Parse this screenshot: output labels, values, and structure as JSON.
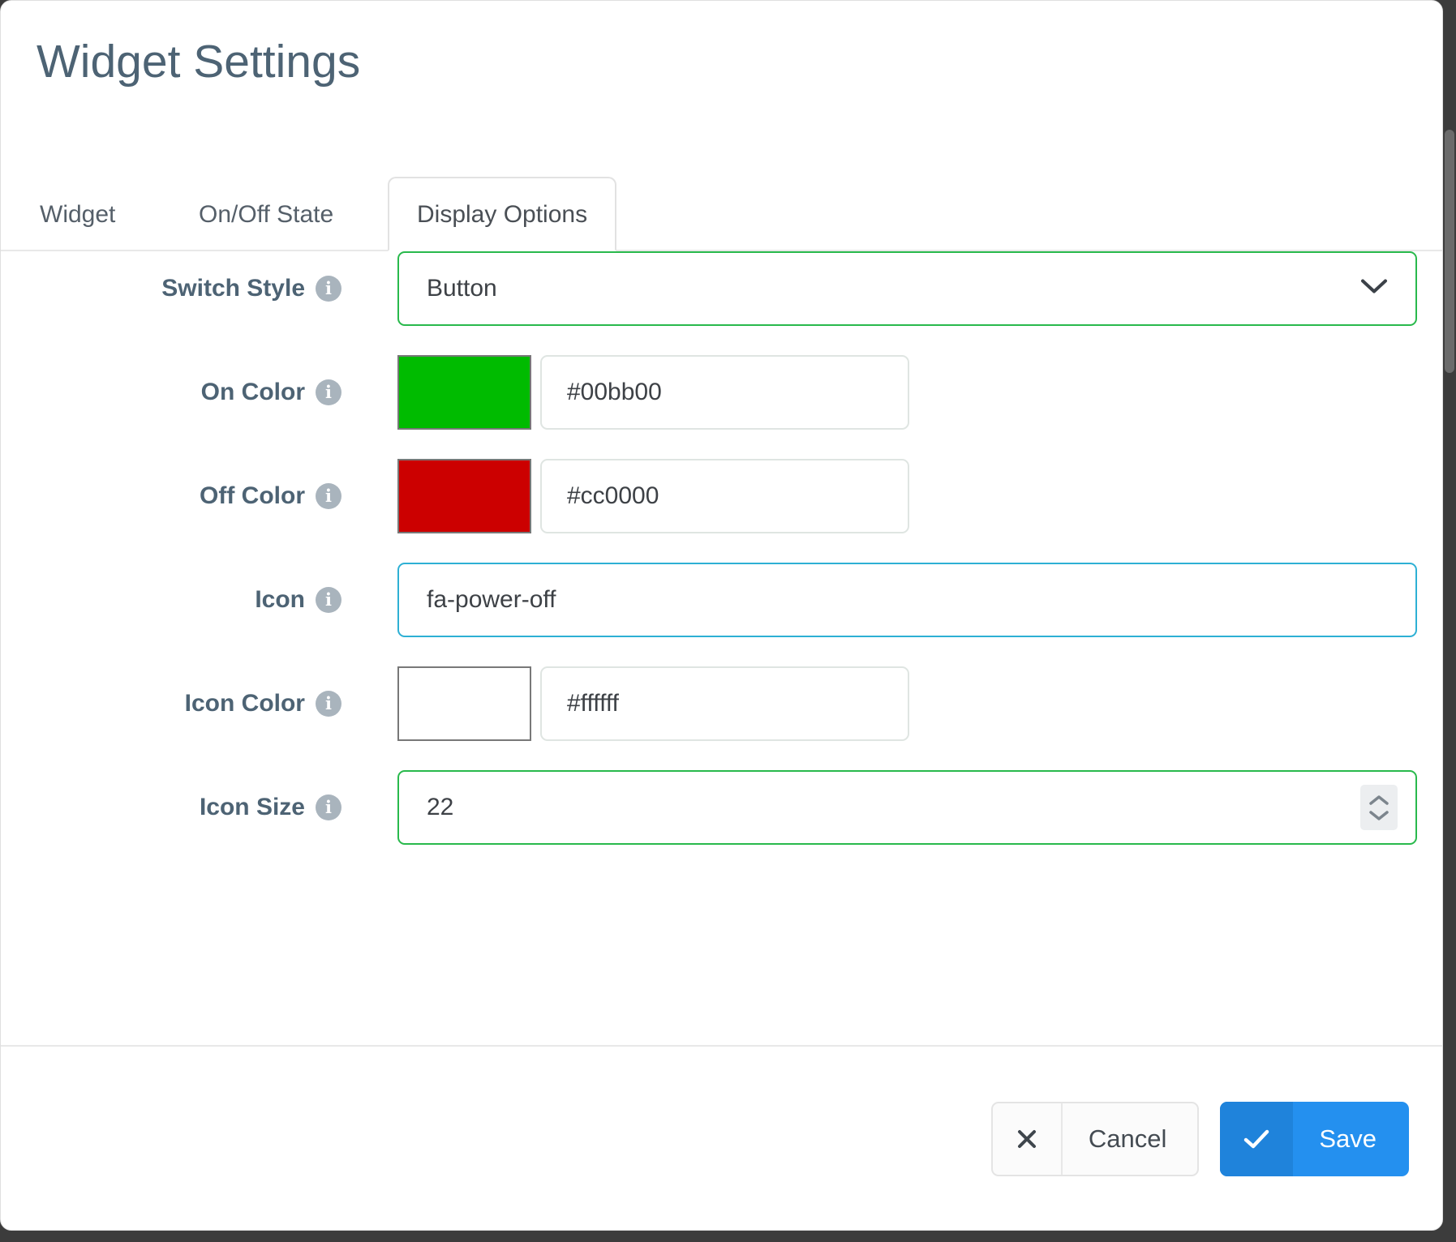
{
  "dialog": {
    "title": "Widget Settings"
  },
  "tabs": [
    {
      "label": "Widget",
      "active": false
    },
    {
      "label": "On/Off State",
      "active": false
    },
    {
      "label": "Display Options",
      "active": true
    }
  ],
  "form": {
    "rows": [
      {
        "label": "Switch Style",
        "info_icon": "info-icon",
        "type": "select",
        "value": "Button",
        "chevron_icon": "chevron-down-icon",
        "border_color": "#29b94c"
      },
      {
        "label": "On Color",
        "info_icon": "info-icon",
        "type": "color",
        "swatch_color": "#00bb00",
        "value": "#00bb00",
        "border_color": "#dfe5e2"
      },
      {
        "label": "Off Color",
        "info_icon": "info-icon",
        "type": "color",
        "swatch_color": "#cc0000",
        "value": "#cc0000",
        "border_color": "#dfe5e2"
      },
      {
        "label": "Icon",
        "info_icon": "info-icon",
        "type": "text",
        "value": "fa-power-off",
        "border_color": "#2eb0d4"
      },
      {
        "label": "Icon Color",
        "info_icon": "info-icon",
        "type": "color",
        "swatch_color": "#ffffff",
        "value": "#ffffff",
        "border_color": "#dfe5e2"
      },
      {
        "label": "Icon Size",
        "info_icon": "info-icon",
        "type": "number",
        "value": "22",
        "spinner_icon": "stepper-updown-icon",
        "border_color": "#29b94c"
      }
    ]
  },
  "footer": {
    "cancel_label": "Cancel",
    "cancel_icon": "close-x-icon",
    "save_label": "Save",
    "save_icon": "check-icon",
    "save_color": "#2490ef"
  }
}
